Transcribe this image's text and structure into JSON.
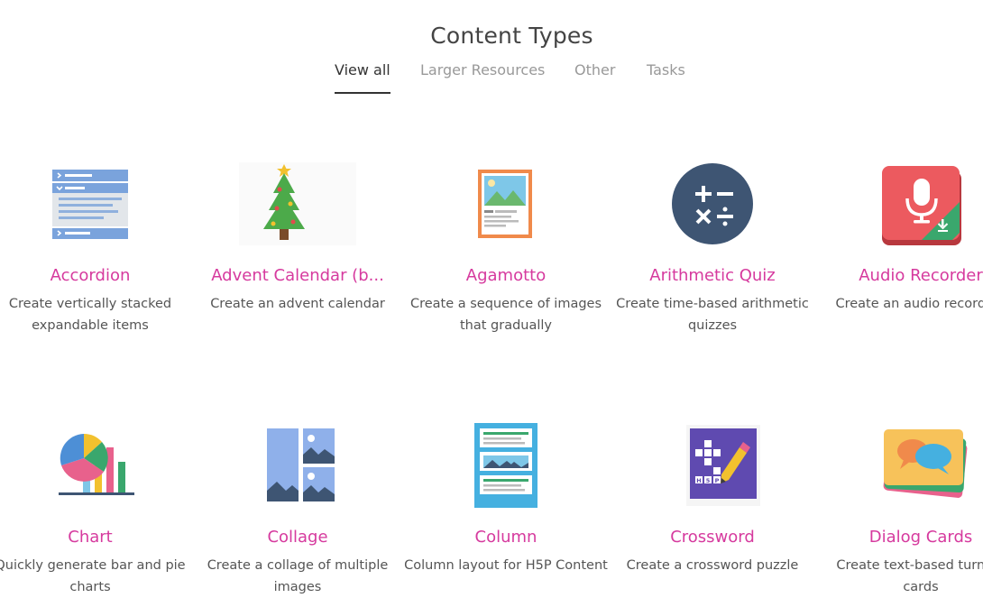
{
  "page": {
    "title": "Content Types"
  },
  "tabs": [
    {
      "label": "View all",
      "active": true
    },
    {
      "label": "Larger Resources",
      "active": false
    },
    {
      "label": "Other",
      "active": false
    },
    {
      "label": "Tasks",
      "active": false
    }
  ],
  "cards": [
    {
      "name": "Accordion",
      "desc": "Create vertically stacked expandable items",
      "icon": "accordion-icon"
    },
    {
      "name": "Advent Calendar (b...",
      "desc": "Create an advent calendar",
      "icon": "advent-tree-icon"
    },
    {
      "name": "Agamotto",
      "desc": "Create a sequence of images that gradually",
      "icon": "agamotto-icon"
    },
    {
      "name": "Arithmetic Quiz",
      "desc": "Create time-based arithmetic quizzes",
      "icon": "arithmetic-icon"
    },
    {
      "name": "Audio Recorder",
      "desc": "Create an audio recording",
      "icon": "microphone-icon"
    },
    {
      "name": "Chart",
      "desc": "Quickly generate bar and pie charts",
      "icon": "chart-icon"
    },
    {
      "name": "Collage",
      "desc": "Create a collage of multiple images",
      "icon": "collage-icon"
    },
    {
      "name": "Column",
      "desc": "Column layout for H5P Content",
      "icon": "column-icon"
    },
    {
      "name": "Crossword",
      "desc": "Create a crossword puzzle",
      "icon": "crossword-icon"
    },
    {
      "name": "Dialog Cards",
      "desc": "Create text-based turning cards",
      "icon": "dialog-cards-icon"
    }
  ],
  "icon_text": {
    "crossword": "H5P"
  },
  "colors": {
    "accent": "#d63a9e",
    "title": "#444444",
    "active_tab": "#333333",
    "inactive_tab": "#999999"
  }
}
